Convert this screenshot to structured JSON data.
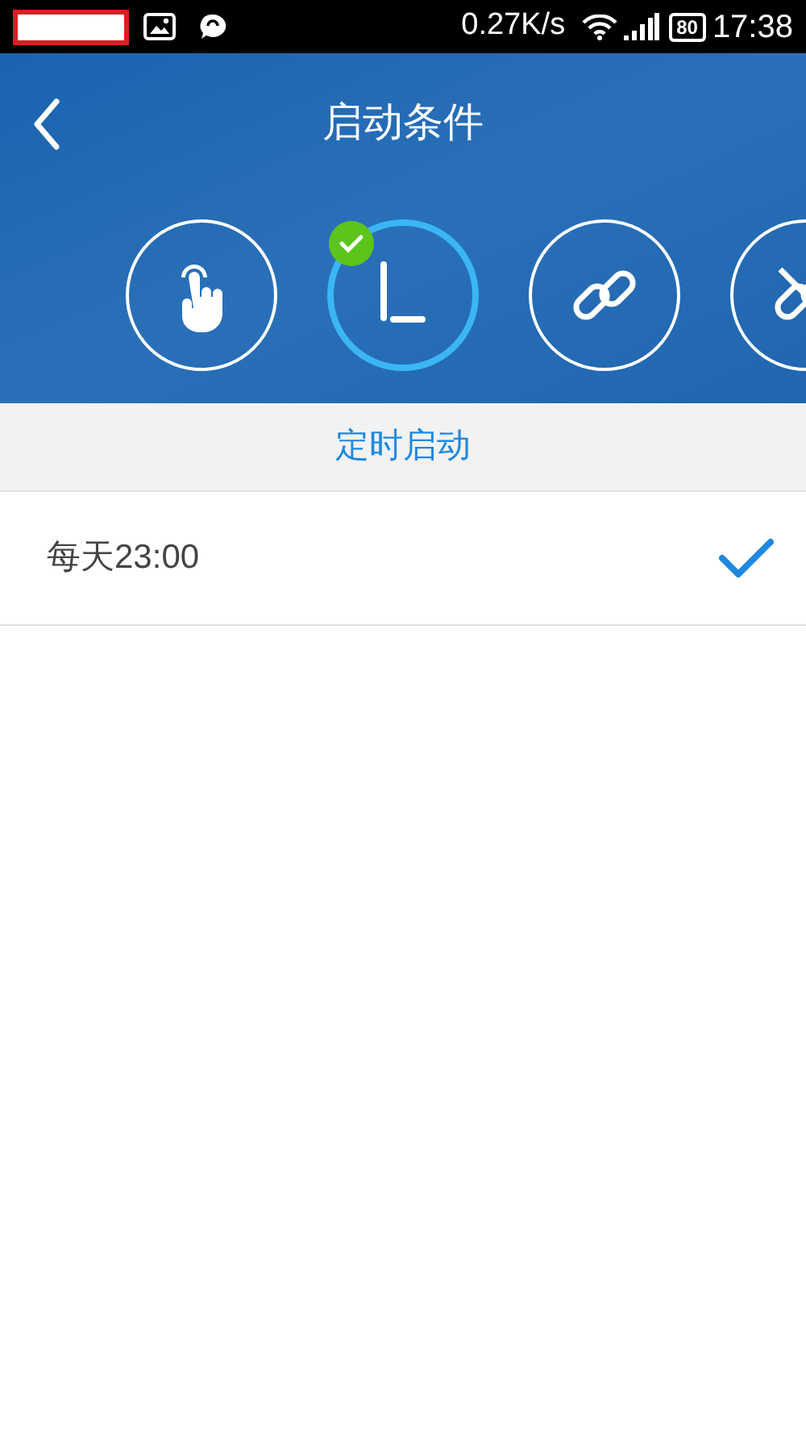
{
  "status_bar": {
    "speed": "0.27K/s",
    "battery": "80",
    "time": "17:38"
  },
  "header": {
    "title": "启动条件"
  },
  "triggers": [
    {
      "kind": "touch",
      "selected": false
    },
    {
      "kind": "clock",
      "selected": true
    },
    {
      "kind": "link",
      "selected": false
    },
    {
      "kind": "unlink",
      "selected": false
    }
  ],
  "section": {
    "title": "定时启动"
  },
  "rows": [
    {
      "label": "每天23:00",
      "selected": true
    }
  ]
}
